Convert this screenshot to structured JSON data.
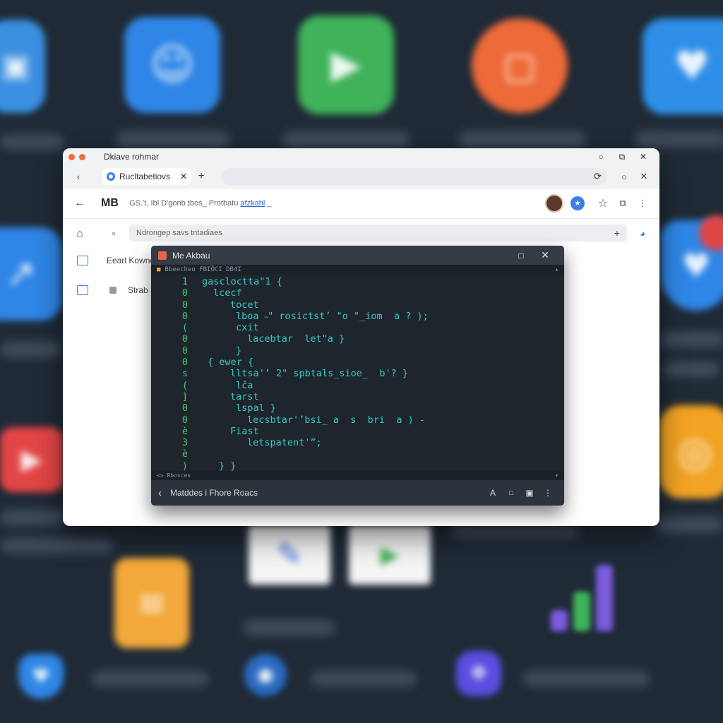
{
  "browser": {
    "window_title": "Dkiave rohmar",
    "tab_label": "Rucltabetiovs",
    "brand": "M⁠В",
    "nav_url_prefix": "GS.ʻt, Ibl D'gonb ṭbos_ Protbatu",
    "nav_url_link": "afzkahl",
    "nav_url_suffix": "_",
    "search_placeholder": "Ndrongep savs tntadiaes",
    "sidebar_items": [
      {
        "label": "Eearl Kowne"
      },
      {
        "label": "Strab"
      }
    ]
  },
  "terminal": {
    "title": "Me Akbau",
    "subheader_path": "Bbeecheo    FBIŎCI  DB4I",
    "status_text": "<> Rbosces",
    "footer_text": "Matddes i Fhore Roacs",
    "lines": [
      {
        "num": "1",
        "indent": "",
        "text": "gascloctta\"1 {"
      },
      {
        "num": "0",
        "indent": "  ",
        "text": "lcecf"
      },
      {
        "num": "0",
        "indent": "     ",
        "text": "tocet"
      },
      {
        "num": "0",
        "indent": "      ",
        "text": "lboa ˵\" rosictstʼ \"o \"_iom  a ? );"
      },
      {
        "num": "(",
        "indent": "      ",
        "text": "cxit"
      },
      {
        "num": "0",
        "indent": "        ",
        "text": "lacebtar  let\"a }"
      },
      {
        "num": "0",
        "indent": "      ",
        "text": "}"
      },
      {
        "num": "0",
        "indent": " ",
        "text": "{ ewer {"
      },
      {
        "num": "s",
        "indent": "     ",
        "text": "lltsa'ʼ 2\" spbtals_sioe_  b'? }"
      },
      {
        "num": "(",
        "indent": "      ",
        "text": "lča"
      },
      {
        "num": "]",
        "indent": "     ",
        "text": "tarst"
      },
      {
        "num": "0",
        "indent": "      ",
        "text": "lspal }"
      },
      {
        "num": "0",
        "indent": "        ",
        "text": "lecsbtar'ʼbsi_ a  s  bri  a ) -"
      },
      {
        "num": "è",
        "indent": "     ",
        "text": "Fiast"
      },
      {
        "num": "3",
        "indent": "        ",
        "text": "letspatent'”;"
      },
      {
        "num": "è",
        "indent": "",
        "text": ""
      },
      {
        "num": ")",
        "indent": "   ",
        "text": "} }"
      }
    ]
  },
  "desktop": {
    "icons": [
      {
        "name": "folder-app-icon",
        "color": "#3a8fe0",
        "glyph": "▣"
      },
      {
        "name": "people-app-icon",
        "color": "#2f86e6",
        "glyph": "☺"
      },
      {
        "name": "play-chat-app-icon",
        "color": "#3fb25a",
        "glyph": "▶"
      },
      {
        "name": "orange-app-icon",
        "color": "#ee6a38",
        "glyph": "▢"
      },
      {
        "name": "chat-app-icon",
        "color": "#2f8fe8",
        "glyph": "♥"
      },
      {
        "name": "share-app-icon",
        "color": "#2f86e6",
        "glyph": "↗"
      },
      {
        "name": "heart-shield-app-icon",
        "color": "#2f86e6",
        "glyph": "♥"
      },
      {
        "name": "youtube-app-icon",
        "color": "#e24545",
        "glyph": "▶"
      },
      {
        "name": "ring-app-icon",
        "color": "#f2a323",
        "glyph": "◎"
      },
      {
        "name": "pen-doc-app-icon",
        "color": "#f5f5f5",
        "glyph": "✎"
      },
      {
        "name": "play-doc-app-icon",
        "color": "#f5f5f5",
        "glyph": "▶"
      },
      {
        "name": "notes-app-icon",
        "color": "#f2a83a",
        "glyph": "≡"
      },
      {
        "name": "chart-app-icon",
        "color": "#7a5bdc",
        "glyph": "▇"
      },
      {
        "name": "shield-app-icon",
        "color": "#2f86e6",
        "glyph": "♥"
      },
      {
        "name": "globe-app-icon",
        "color": "#2a6bc2",
        "glyph": "●"
      },
      {
        "name": "link-app-icon",
        "color": "#5a4ee0",
        "glyph": "❖"
      }
    ]
  }
}
